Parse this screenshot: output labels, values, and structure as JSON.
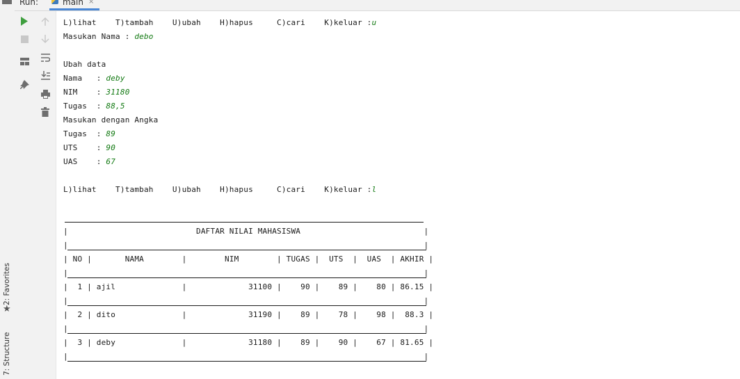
{
  "run_panel": {
    "label": "Run:",
    "tab": {
      "label": "main",
      "close": "×"
    }
  },
  "side_tabs": {
    "favorites": "2: Favorites",
    "structure": "7: Structure"
  },
  "toolbar_icons": {
    "run": "play-icon",
    "stop": "stop-icon",
    "layout": "layout-icon",
    "pin": "pin-icon",
    "up": "arrow-up-icon",
    "down": "arrow-down-icon",
    "soft_wrap": "soft-wrap-icon",
    "scroll_end": "scroll-to-end-icon",
    "print": "print-icon",
    "clear": "trash-icon"
  },
  "colors": {
    "user_input": "#107810",
    "accent_tab": "#4a87d6"
  },
  "console": {
    "lines": [
      {
        "text": "L)lihat    T)tambah    U)ubah    H)hapus     C)cari    K)keluar :",
        "input": "u"
      },
      {
        "text": "Masukan Nama : ",
        "input": "debo"
      },
      {
        "text": "",
        "input": ""
      },
      {
        "text": "Ubah data",
        "input": ""
      },
      {
        "text": "Nama   : ",
        "input": "deby"
      },
      {
        "text": "NIM    : ",
        "input": "31180"
      },
      {
        "text": "Tugas  : ",
        "input": "88,5"
      },
      {
        "text": "Masukan dengan Angka",
        "input": ""
      },
      {
        "text": "Tugas  : ",
        "input": "89"
      },
      {
        "text": "UTS    : ",
        "input": "90"
      },
      {
        "text": "UAS    : ",
        "input": "67"
      },
      {
        "text": "",
        "input": ""
      },
      {
        "text": "L)lihat    T)tambah    U)ubah    H)hapus     C)cari    K)keluar :",
        "input": "l"
      },
      {
        "text": "",
        "input": ""
      },
      {
        "text": "",
        "input": ""
      },
      {
        "text": "|                           DAFTAR NILAI MAHASISWA                          |",
        "input": ""
      },
      {
        "text": "|                                                                           |",
        "input": ""
      },
      {
        "text": "| NO |       NAMA        |        NIM        | TUGAS |  UTS  |  UAS  | AKHIR |",
        "input": ""
      },
      {
        "text": "|                                                                           |",
        "input": ""
      },
      {
        "text": "|  1 | ajil              |             31100 |    90 |    89 |    80 | 86.15 |",
        "input": ""
      },
      {
        "text": "|                                                                           |",
        "input": ""
      },
      {
        "text": "|  2 | dito              |             31190 |    89 |    78 |    98 |  88.3 |",
        "input": ""
      },
      {
        "text": "|                                                                           |",
        "input": ""
      },
      {
        "text": "|  3 | deby              |             31180 |    89 |    90 |    67 | 81.65 |",
        "input": ""
      },
      {
        "text": "|                                                                           |",
        "input": ""
      }
    ]
  }
}
